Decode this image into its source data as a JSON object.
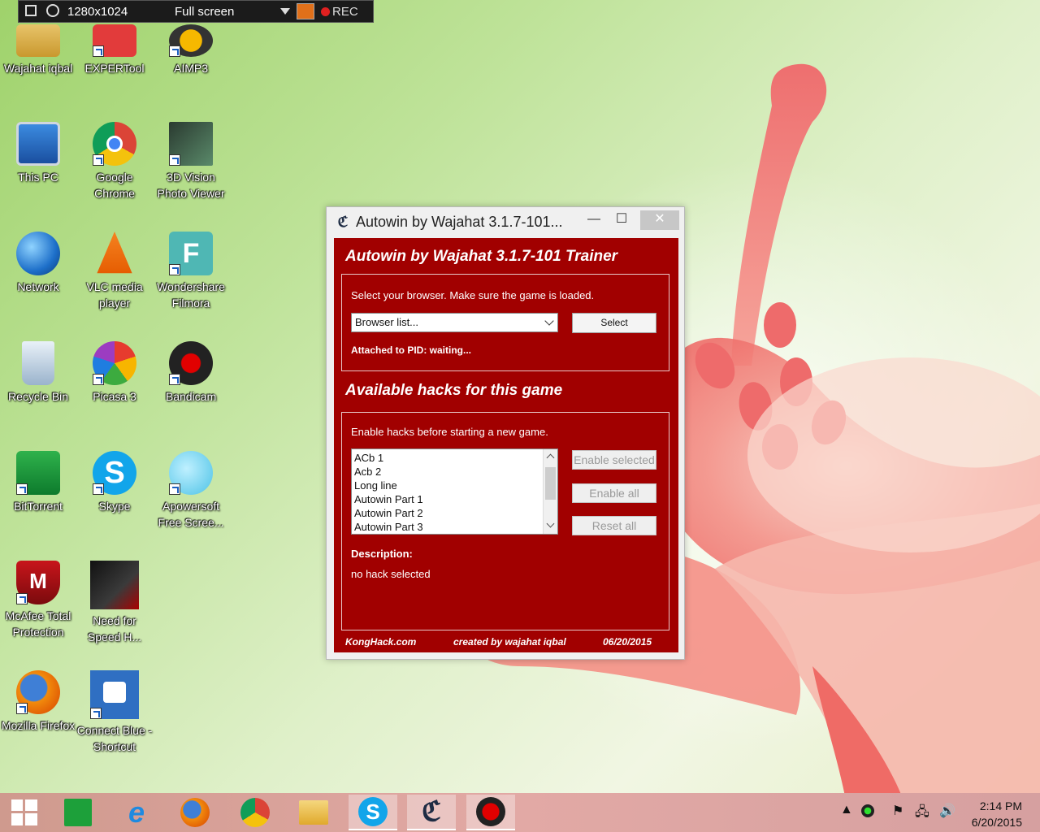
{
  "recorder": {
    "resolution": "1280x1024",
    "mode": "Full screen",
    "rec_label": "REC"
  },
  "desktop_icons": [
    {
      "label": "Wajahat iqbal"
    },
    {
      "label": "EXPERTool"
    },
    {
      "label": "AIMP3"
    },
    {
      "label": "This PC"
    },
    {
      "label": "Google Chrome"
    },
    {
      "label": "3D Vision Photo Viewer"
    },
    {
      "label": "Network"
    },
    {
      "label": "VLC media player"
    },
    {
      "label": "Wondershare Filmora"
    },
    {
      "label": "Recycle Bin"
    },
    {
      "label": "Picasa 3"
    },
    {
      "label": "Bandicam"
    },
    {
      "label": "BitTorrent"
    },
    {
      "label": "Skype"
    },
    {
      "label": "Apowersoft Free Scree..."
    },
    {
      "label": "McAfee Total Protection"
    },
    {
      "label": "Need for Speed H..."
    },
    {
      "label": "Mozilla Firefox"
    },
    {
      "label": "Connect Blue - Shortcut"
    }
  ],
  "window": {
    "title": "Autowin by Wajahat  3.1.7-101...",
    "heading": "Autowin by Wajahat  3.1.7-101 Trainer",
    "browser_prompt": "Select your browser. Make sure the game is loaded.",
    "browser_select_value": "Browser list...",
    "select_button": "Select",
    "attached_status": "Attached to PID: waiting...",
    "hacks_heading": "Available hacks for this game",
    "hacks_prompt": "Enable hacks before starting a new game.",
    "hacks": [
      "ACb 1",
      "Acb 2",
      "Long line",
      "Autowin Part 1",
      "Autowin Part 2",
      "Autowin Part 3"
    ],
    "enable_selected_button": "Enable selected",
    "enable_all_button": "Enable all",
    "reset_all_button": "Reset all",
    "description_label": "Description:",
    "description_value": "no hack selected",
    "footer_site": "KongHack.com",
    "footer_author": "created by wajahat iqbal",
    "footer_date": "06/20/2015",
    "minimize_glyph": "—",
    "maximize_glyph": "☐",
    "close_glyph": "✕"
  },
  "taskbar": {
    "apps": [
      "start-icon",
      "store-icon",
      "internet-explorer-icon",
      "firefox-icon",
      "chrome-icon",
      "file-explorer-icon",
      "skype-icon",
      "cheat-engine-icon",
      "bandicam-icon"
    ],
    "clock_time": "2:14 PM",
    "clock_date": "6/20/2015"
  },
  "colors": {
    "trainer_red": "#a10000",
    "desktop_green": "#9fd26b",
    "flower_pink": "#f07070"
  }
}
